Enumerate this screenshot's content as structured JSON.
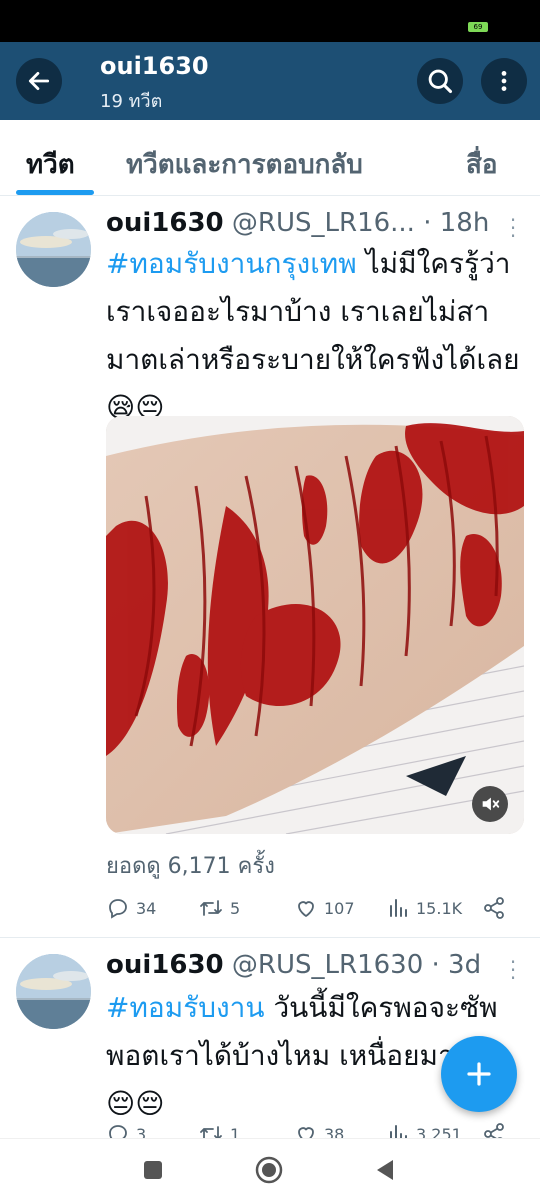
{
  "status_bar": {
    "battery": "69"
  },
  "app_bar": {
    "title": "oui1630",
    "subtitle": "19 ทวีต",
    "back_icon": "arrow-left-icon",
    "search_icon": "search-icon",
    "more_icon": "more-vertical-icon"
  },
  "tabs": [
    {
      "label": "ทวีต",
      "active": true
    },
    {
      "label": "ทวีตและการตอบกลับ",
      "active": false
    },
    {
      "label": "สื่อ",
      "active": false
    }
  ],
  "tweets": [
    {
      "name": "oui1630",
      "handle": "@RUS_LR16...",
      "separator": "·",
      "time": "18h",
      "hashtag": "#ทอมรับงานกรุงเทพ",
      "text": " ไม่มีใครรู้ว่าเราเจออะไรมาบ้าง เราเลยไม่สามาตเล่าหรือระบายให้ใครฟังได้เลย😪😔",
      "media": {
        "type": "image",
        "description_icon": "sensitive-media",
        "mute_icon": "volume-muted-icon"
      },
      "views_line": "ยอดดู 6,171 ครั้ง",
      "actions": {
        "replies": "34",
        "retweets": "5",
        "likes": "107",
        "views": "15.1K"
      }
    },
    {
      "name": "oui1630",
      "handle": "@RUS_LR1630",
      "separator": "·",
      "time": "3d",
      "hashtag": "#ทอมรับงาน",
      "text": "  วันนี้มีใครพอจะซัพพอตเราได้บ้างไหม เหนื่อยมากจัง😔😔",
      "actions": {
        "replies": "3",
        "retweets": "1",
        "likes": "38",
        "views": "3,251"
      }
    }
  ],
  "fab": {
    "icon": "plus-icon"
  },
  "nav_bar": {
    "recent_icon": "square-icon",
    "home_icon": "circle-icon",
    "back_icon": "triangle-back-icon"
  },
  "colors": {
    "appbar": "#1d4f74",
    "accent": "#1d9bf0",
    "blood": "#b01010"
  }
}
